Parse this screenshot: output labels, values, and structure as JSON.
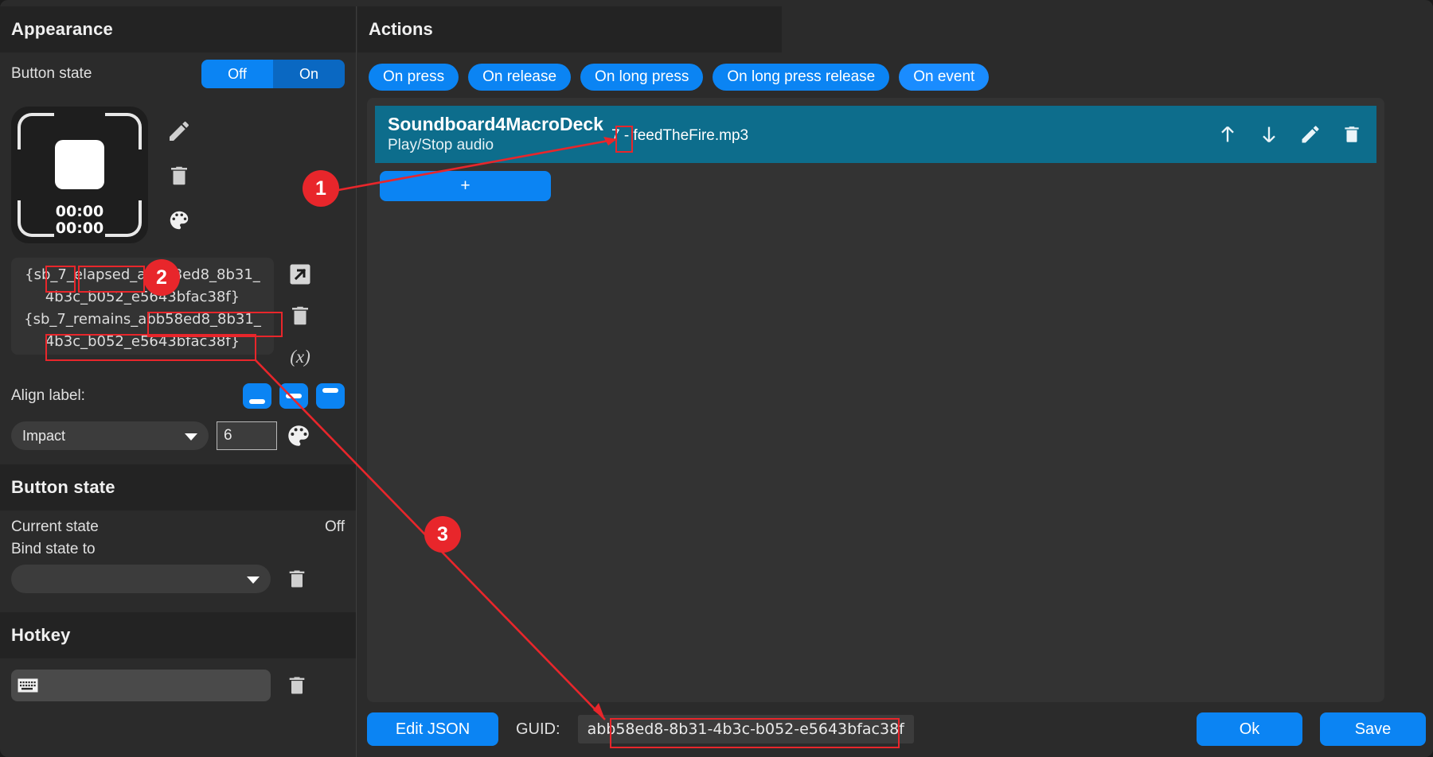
{
  "window": {
    "close_icon": "close-icon"
  },
  "appearance": {
    "title": "Appearance",
    "button_state_label": "Button state",
    "toggle_off": "Off",
    "toggle_on": "On",
    "preview": {
      "line1": "00:00",
      "line2": "00:00"
    },
    "preview_tools": [
      {
        "icon": "pencil-icon"
      },
      {
        "icon": "trash-icon"
      },
      {
        "icon": "palette-icon"
      }
    ],
    "label_text": "{sb_7_elapsed_abb58ed8_8b31_4b3c_b052_e5643bfac38f}{sb_7_remains_abb58ed8_8b31_4b3c_b052_e5643bfac38f}",
    "label_line1": "{sb_7_elapsed_abb58ed8_8b31_",
    "label_line2": "4b3c_b052_e5643bfac38f}",
    "label_line3": "{sb_7_remains_abb58ed8_8b31_",
    "label_line4": "4b3c_b052_e5643bfac38f}",
    "label_tools": [
      {
        "icon": "external-link-icon"
      },
      {
        "icon": "trash-icon"
      },
      {
        "icon": "variable-icon",
        "label": "(x)"
      }
    ],
    "align_label": "Align label:",
    "align_options": [
      "bottom",
      "middle",
      "top"
    ],
    "font_family": "Impact",
    "font_size": "6",
    "font_color_icon": "palette-icon"
  },
  "button_state": {
    "title": "Button state",
    "current_state_label": "Current state",
    "current_state_value": "Off",
    "bind_state_label": "Bind state to",
    "bind_state_value": "",
    "delete_icon": "trash-icon"
  },
  "hotkey": {
    "title": "Hotkey",
    "value": "",
    "input_icon": "keyboard-icon",
    "delete_icon": "trash-icon"
  },
  "actions": {
    "title": "Actions",
    "tabs": [
      {
        "label": "On press",
        "accent": false
      },
      {
        "label": "On release",
        "accent": false
      },
      {
        "label": "On long press",
        "accent": false
      },
      {
        "label": "On long press release",
        "accent": false
      },
      {
        "label": "On event",
        "accent": true
      }
    ],
    "items": [
      {
        "title": "Soundboard4MacroDeck",
        "subtitle": "Play/Stop audio",
        "param_index": "7",
        "param_text": "- feedTheFire.mp3",
        "icons": [
          "move-up-icon",
          "move-down-icon",
          "pencil-icon",
          "trash-icon"
        ]
      }
    ],
    "add_button": "+"
  },
  "footer": {
    "edit_json": "Edit JSON",
    "guid_label": "GUID:",
    "guid_value": "abb58ed8-8b31-4b3c-b052-e5643bfac38f",
    "ok": "Ok",
    "save": "Save"
  },
  "annotations": [
    {
      "number": "1"
    },
    {
      "number": "2"
    },
    {
      "number": "3"
    }
  ],
  "colors": {
    "accent_blue": "#0b84f3",
    "accent_blue_bright": "#1a8cff",
    "accent_blue_dark": "#0a68c2",
    "action_teal": "#0d6d8c",
    "annotation_red": "#e8262b",
    "panel_bg": "#2b2b2b",
    "header_bg": "#232323"
  }
}
